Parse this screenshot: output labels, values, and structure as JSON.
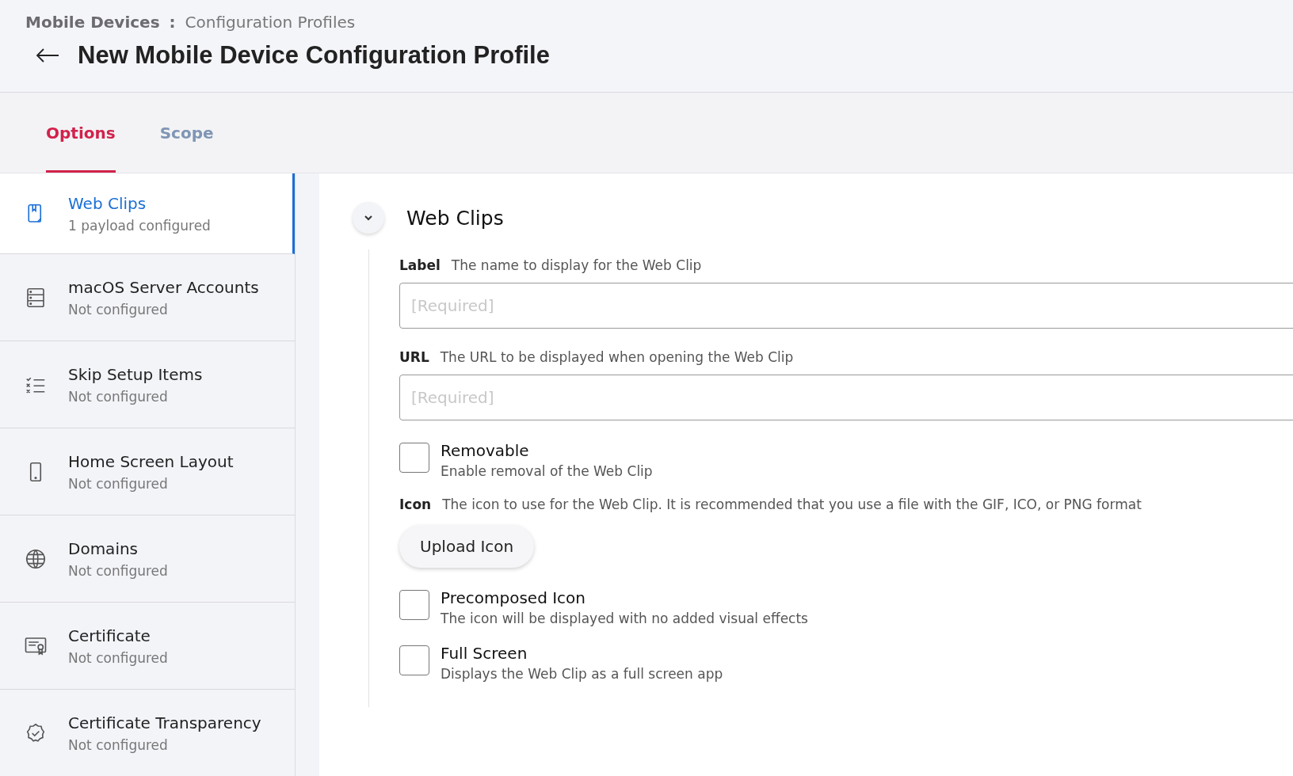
{
  "breadcrumb": {
    "parent": "Mobile Devices",
    "separator": ":",
    "current": "Configuration Profiles"
  },
  "page_title": "New Mobile Device Configuration Profile",
  "tabs": [
    {
      "label": "Options",
      "selected": true
    },
    {
      "label": "Scope",
      "selected": false
    }
  ],
  "sidebar": {
    "items": [
      {
        "title": "Web Clips",
        "status": "1 payload configured",
        "selected": true
      },
      {
        "title": "macOS Server Accounts",
        "status": "Not configured",
        "selected": false
      },
      {
        "title": "Skip Setup Items",
        "status": "Not configured",
        "selected": false
      },
      {
        "title": "Home Screen Layout",
        "status": "Not configured",
        "selected": false
      },
      {
        "title": "Domains",
        "status": "Not configured",
        "selected": false
      },
      {
        "title": "Certificate",
        "status": "Not configured",
        "selected": false
      },
      {
        "title": "Certificate Transparency",
        "status": "Not configured",
        "selected": false
      }
    ]
  },
  "section": {
    "title": "Web Clips",
    "expanded": true,
    "fields": [
      {
        "kind": "text",
        "label": "Label",
        "description": "The name to display for the Web Clip",
        "placeholder": "[Required]"
      },
      {
        "kind": "text",
        "label": "URL",
        "description": "The URL to be displayed when opening the Web Clip",
        "placeholder": "[Required]"
      },
      {
        "kind": "checkbox",
        "label": "Removable",
        "description": "Enable removal of the Web Clip",
        "checked": false
      },
      {
        "kind": "upload",
        "label": "Icon",
        "description": "The icon to use for the Web Clip. It is recommended that you use a file with the GIF, ICO, or PNG format",
        "button": "Upload Icon"
      },
      {
        "kind": "checkbox",
        "label": "Precomposed Icon",
        "description": "The icon will be displayed with no added visual effects",
        "checked": false
      },
      {
        "kind": "checkbox",
        "label": "Full Screen",
        "description": "Displays the Web Clip as a full screen app",
        "checked": false
      }
    ]
  }
}
